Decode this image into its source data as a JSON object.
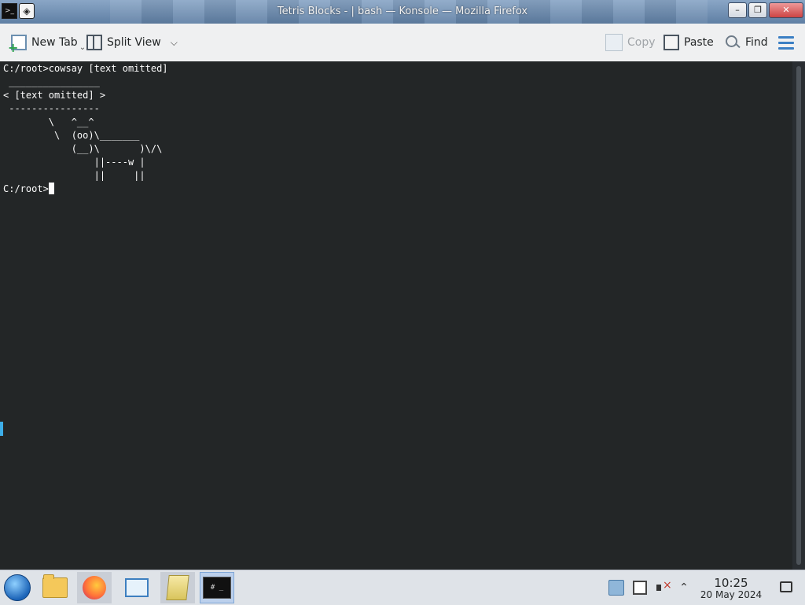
{
  "window": {
    "title": "Tetris Blocks - | bash — Konsole — Mozilla Firefox"
  },
  "toolbar": {
    "new_tab": "New Tab",
    "split_view": "Split View",
    "copy": "Copy",
    "paste": "Paste",
    "find": "Find"
  },
  "terminal": {
    "lines": [
      "C:/root>cowsay [text omitted]",
      " ________________",
      "< [text omitted] >",
      " ----------------",
      "        \\   ^__^",
      "         \\  (oo)\\_______",
      "            (__)\\       )\\/\\",
      "                ||----w |",
      "                ||     ||",
      "C:/root>"
    ]
  },
  "taskbar": {
    "konsole_label": "# _",
    "clock_time": "10:25",
    "clock_date": "20 May 2024"
  }
}
